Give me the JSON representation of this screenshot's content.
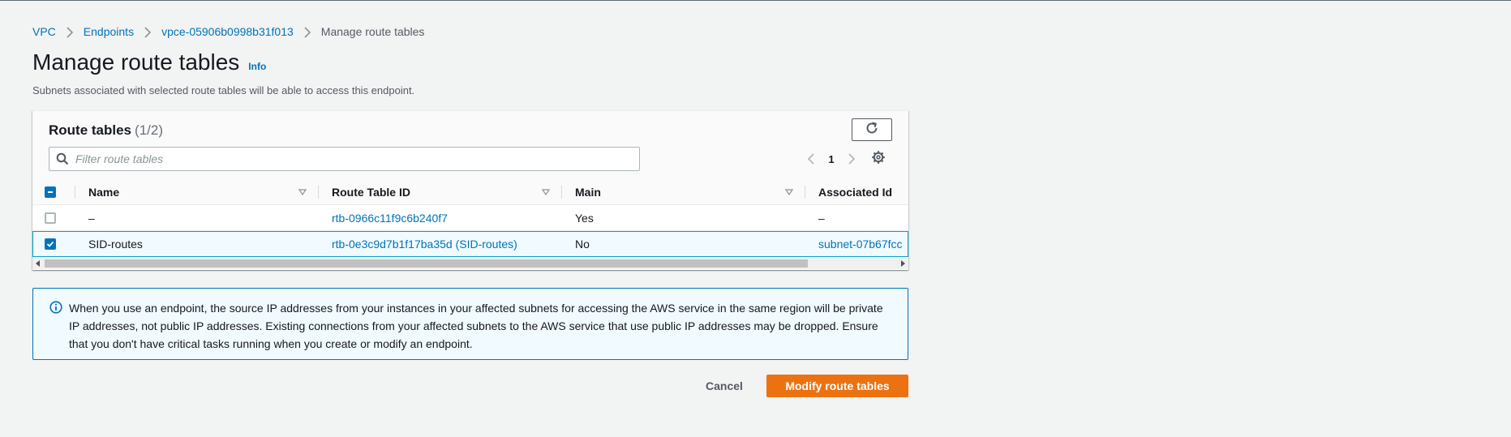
{
  "breadcrumb": {
    "items": [
      {
        "label": "VPC"
      },
      {
        "label": "Endpoints"
      },
      {
        "label": "vpce-05906b0998b31f013"
      }
    ],
    "current": "Manage route tables"
  },
  "page": {
    "title": "Manage route tables",
    "info_label": "Info",
    "description": "Subnets associated with selected route tables will be able to access this endpoint."
  },
  "route_tables": {
    "title": "Route tables",
    "count": "(1/2)",
    "filter": {
      "placeholder": "Filter route tables",
      "value": ""
    },
    "pagination": {
      "current_page": "1"
    },
    "columns": [
      "Name",
      "Route Table ID",
      "Main",
      "Associated Id"
    ],
    "rows": [
      {
        "selected": false,
        "name": "–",
        "route_table_id": "rtb-0966c11f9c6b240f7",
        "main": "Yes",
        "associated_id": "–"
      },
      {
        "selected": true,
        "name": "SID-routes",
        "route_table_id": "rtb-0e3c9d7b1f17ba35d (SID-routes)",
        "main": "No",
        "associated_id": "subnet-07b67fcc"
      }
    ]
  },
  "alert": {
    "icon": "info-icon",
    "text": "When you use an endpoint, the source IP addresses from your instances in your affected subnets for accessing the AWS service in the same region will be private IP addresses, not public IP addresses. Existing connections from your affected subnets to the AWS service that use public IP addresses may be dropped. Ensure that you don't have critical tasks running when you create or modify an endpoint."
  },
  "actions": {
    "cancel_label": "Cancel",
    "submit_label": "Modify route tables"
  },
  "colors": {
    "link": "#0073bb",
    "primary_button": "#ec7211",
    "selected_row_border": "#00a1c9",
    "background": "#f2f3f3"
  }
}
